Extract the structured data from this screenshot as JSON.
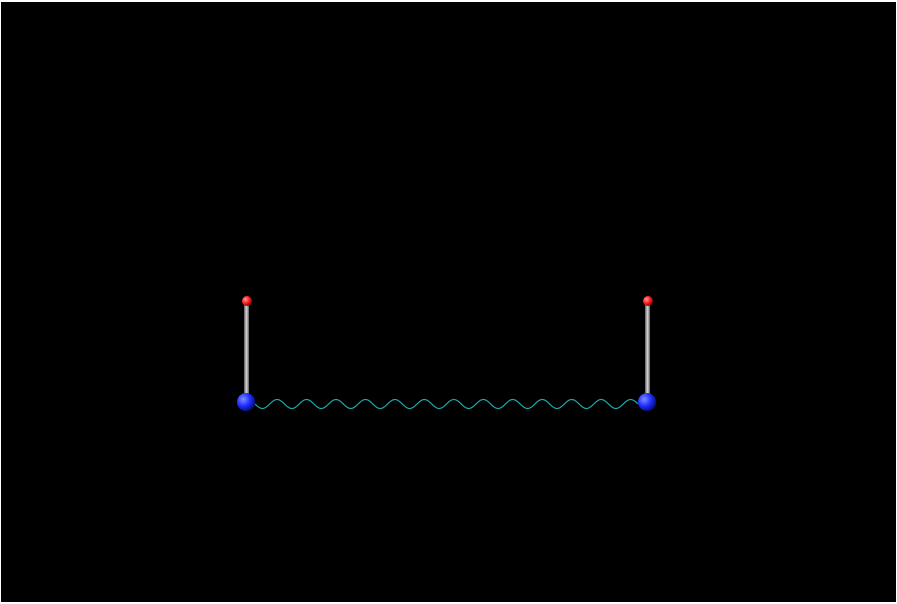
{
  "scene": {
    "background_color": "#000000",
    "atoms": [
      {
        "role": "base",
        "element_color": "#1a2cff",
        "highlight_color": "#7f8cff"
      },
      {
        "role": "top",
        "element_color": "#ff1a1a",
        "highlight_color": "#ff9a9a"
      },
      {
        "role": "base",
        "element_color": "#1a2cff",
        "highlight_color": "#7f8cff"
      },
      {
        "role": "top",
        "element_color": "#ff1a1a",
        "highlight_color": "#ff9a9a"
      }
    ],
    "rods": [
      {
        "from_atom": 0,
        "to_atom": 1,
        "color": "#b0b0b0"
      },
      {
        "from_atom": 2,
        "to_atom": 3,
        "color": "#b0b0b0"
      }
    ],
    "spring": {
      "from_atom": 0,
      "to_atom": 2,
      "color": "#1fa7a7",
      "coils": 13
    }
  }
}
